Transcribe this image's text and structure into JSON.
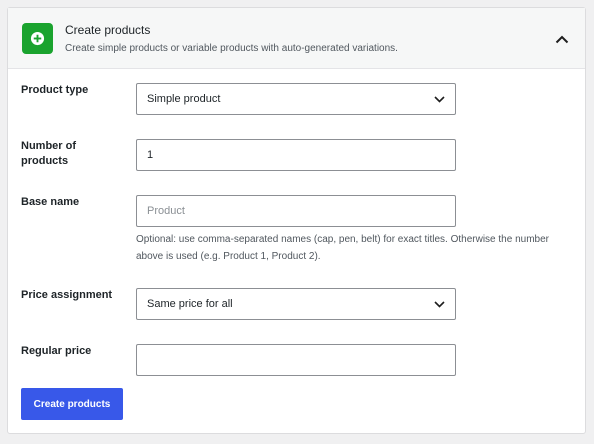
{
  "header": {
    "title": "Create products",
    "subtitle": "Create simple products or variable products with auto-generated variations.",
    "icon": "plus-circle-icon",
    "icon_color": "#1aa32e",
    "collapse_icon": "chevron-up-icon"
  },
  "fields": {
    "product_type": {
      "label": "Product type",
      "value": "Simple product"
    },
    "number_of_products": {
      "label": "Number of products",
      "value": "1"
    },
    "base_name": {
      "label": "Base name",
      "placeholder": "Product",
      "help": "Optional: use comma-separated names (cap, pen, belt) for exact titles. Otherwise the number above is used (e.g. Product 1, Product 2)."
    },
    "price_assignment": {
      "label": "Price assignment",
      "value": "Same price for all"
    },
    "regular_price": {
      "label": "Regular price",
      "value": ""
    }
  },
  "actions": {
    "create_label": "Create products",
    "accent": "#3858e9"
  }
}
